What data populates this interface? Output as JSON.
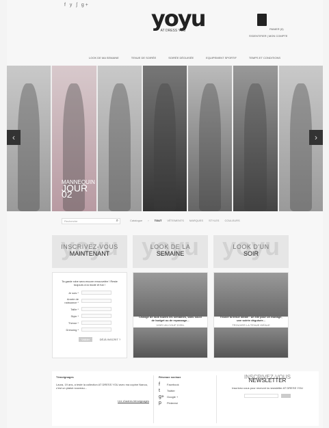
{
  "header": {
    "social_icons": [
      "facebook-icon",
      "twitter-icon",
      "rss-icon",
      "google-plus-icon"
    ],
    "social_glyphs": "f  y  ʃ  g+",
    "logo_mark": "yoyu",
    "logo_sub": "AT DRESS YOU",
    "cart_label": "PANIER (0)",
    "account_links": "S'IDENTIFIER | MON COMPTE"
  },
  "nav": {
    "items": [
      "LOOK DE MA SEMAINE",
      "TENUE DE SOIRÉE",
      "SOIRÉE DÉGUISÉE",
      "EQUIPEMENT SPORTIF",
      "TEMPS ET CONDITIONS"
    ]
  },
  "slider": {
    "tag_line1": "MANNEQUIN",
    "tag_line2": "JOUR",
    "tag_number": "02",
    "prev": "‹",
    "next": "›"
  },
  "search": {
    "placeholder": "Recherche"
  },
  "filters": {
    "catalogue": "Catalogue",
    "separator": "›",
    "items": [
      "TOUT",
      "VÊTEMENTS",
      "MARQUES",
      "STYLES",
      "COULEURS"
    ]
  },
  "promos": [
    {
      "line1": "INSCRIVEZ-VOUS",
      "line2": "MAINTENANT"
    },
    {
      "line1": "LOOK DE LA",
      "line2": "SEMAINE"
    },
    {
      "line1": "LOOK D'UN",
      "line2": "SOIR"
    }
  ],
  "register": {
    "intro": "Ta garde robe sera encore renouvelée ! Reste toujours à la mode et fun !",
    "fields": [
      "Je suis *",
      "Année de naissance *",
      "Taille *",
      "Style *",
      "Thème *",
      "Dressing *"
    ],
    "submit": "Valider",
    "link": "DÉJÀ INSCRIT ?"
  },
  "week_look": {
    "caption": "Change de look toutes les semaines, sans souci de budget ou de repassage...",
    "more": "VOIR UN COUP D'ŒIL"
  },
  "evening_look": {
    "caption": "Trouve la tenue idéale : un rdv pour un mariage, une soirée déguisée...",
    "more": "TROUVER LA TENUE IDÉALE"
  },
  "testimonials": {
    "title": "Témoignages",
    "text": "Laura, 19 ans, a testé la collection AT DRESS YOU avec ma copine Nanou, c'est un plaisir nouveau...",
    "more": "Lire d'autres témoignages"
  },
  "social": {
    "title": "Réseaux sociaux",
    "items": [
      {
        "icon": "facebook-icon",
        "glyph": "f",
        "label": "Facebook"
      },
      {
        "icon": "twitter-icon",
        "glyph": "t",
        "label": "Twitter"
      },
      {
        "icon": "google-plus-icon",
        "glyph": "g+",
        "label": "Google +"
      },
      {
        "icon": "pinterest-icon",
        "glyph": "p",
        "label": "Pinterest"
      }
    ]
  },
  "newsletter": {
    "line1": "INSCRIVEZ-VOUS",
    "line2": "NEWSLETTER",
    "desc": "Inscrivez-vous pour recevoir la newsletter AT DRESS YOU"
  }
}
